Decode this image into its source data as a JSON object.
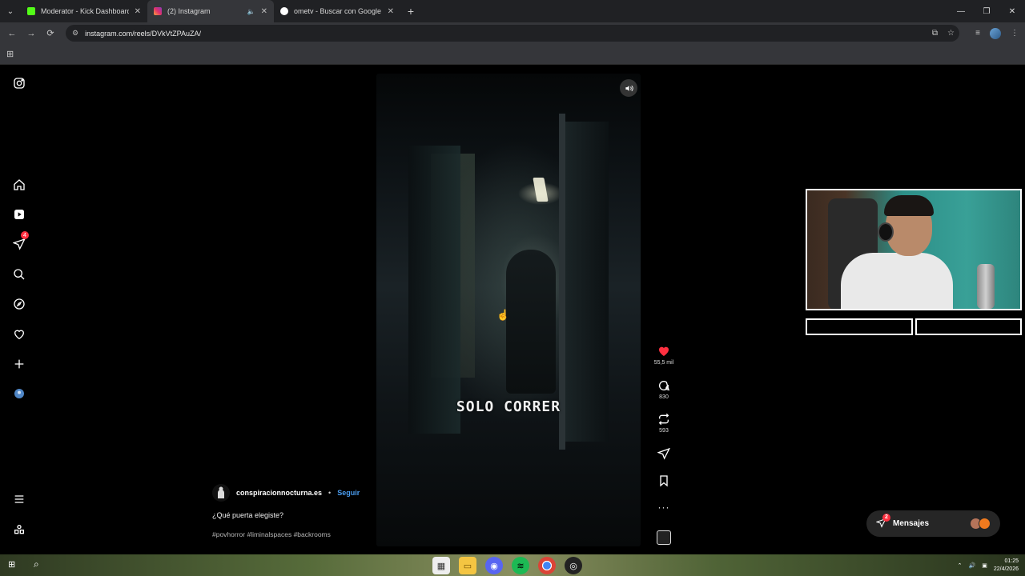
{
  "browser": {
    "tabs": [
      {
        "title": "Moderator - Kick Dashboard",
        "favicon_color": "#53fc18",
        "active": false
      },
      {
        "title": "(2) Instagram",
        "favicon_color": "#e1306c",
        "active": true
      },
      {
        "title": "ometv - Buscar con Google",
        "favicon_color": "#4285f4",
        "active": false
      }
    ],
    "url": "instagram.com/reels/DVkVtZPAuZA/"
  },
  "sidebar": {
    "items": [
      {
        "icon": "instagram-logo-icon"
      },
      {
        "icon": "home-icon"
      },
      {
        "icon": "reels-icon"
      },
      {
        "icon": "messages-icon",
        "badge": "4"
      },
      {
        "icon": "search-icon"
      },
      {
        "icon": "explore-icon"
      },
      {
        "icon": "heart-icon"
      },
      {
        "icon": "create-icon"
      },
      {
        "icon": "profile-icon"
      },
      {
        "icon": "more-menu-icon"
      },
      {
        "icon": "also-from-meta-icon"
      }
    ]
  },
  "reel": {
    "overlay_text": "SOLO CORRER",
    "username": "conspiracionnocturna.es",
    "separator": "•",
    "follow_label": "Seguir",
    "caption": "¿Qué puerta elegiste?",
    "hashtags": "#povhorror #liminalspaces #backrooms",
    "likes": "55,5 mil",
    "comments": "830",
    "reposts": "593",
    "like_color": "#ff3040"
  },
  "messages": {
    "label": "Mensajes",
    "badge": "2"
  },
  "taskbar": {
    "time": "01:25",
    "date": "22/4/2026"
  }
}
